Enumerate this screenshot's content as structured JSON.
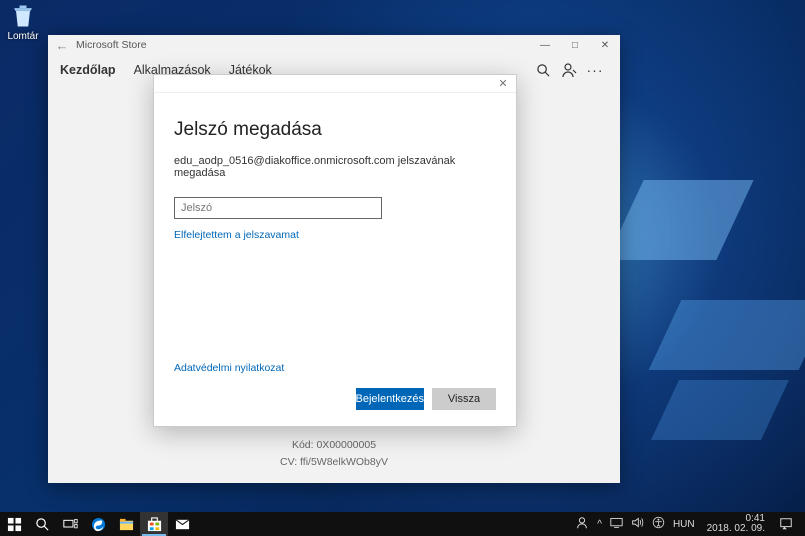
{
  "desktop": {
    "recycle_bin_label": "Lomtár"
  },
  "window": {
    "app_title": "Microsoft Store",
    "tabs": [
      {
        "label": "Kezdőlap"
      },
      {
        "label": "Alkalmazások"
      },
      {
        "label": "Játékok"
      }
    ]
  },
  "footer": {
    "code_label": "Kód: 0X00000005",
    "cv_label": "CV: ffi/5W8elkWOb8yV"
  },
  "dialog": {
    "title": "Jelszó megadása",
    "subtitle": "edu_aodp_0516@diakoffice.onmicrosoft.com jelszavának megadása",
    "password_placeholder": "Jelszó",
    "forgot_link": "Elfelejtettem a jelszavamat",
    "privacy_link": "Adatvédelmi nyilatkozat",
    "signin_label": "Bejelentkezés",
    "back_label": "Vissza"
  },
  "taskbar": {
    "lang": "HUN",
    "time": "0:41",
    "date": "2018. 02. 09."
  }
}
